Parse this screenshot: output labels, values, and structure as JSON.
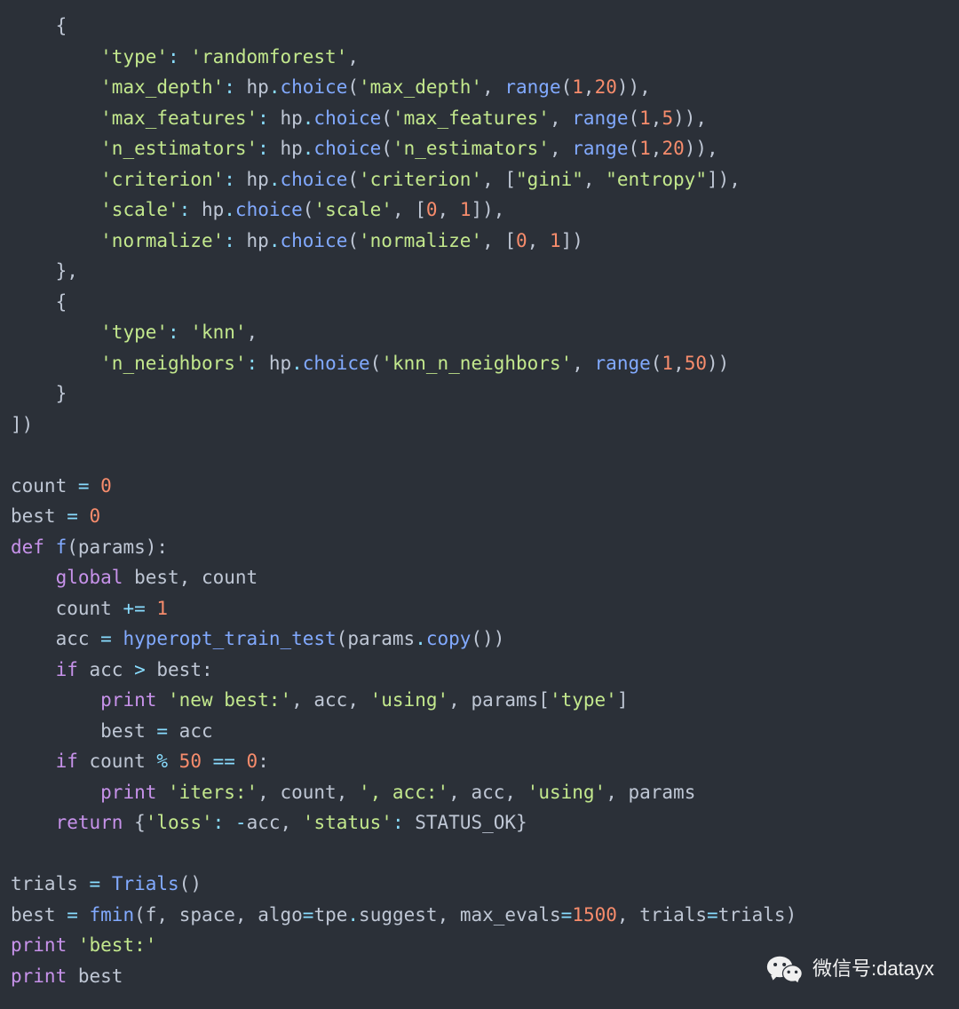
{
  "code": {
    "lines": [
      {
        "indent": 4,
        "tokens": [
          {
            "t": "pn",
            "v": "{"
          }
        ]
      },
      {
        "indent": 8,
        "tokens": [
          {
            "t": "str",
            "v": "'type'"
          },
          {
            "t": "op",
            "v": ": "
          },
          {
            "t": "str",
            "v": "'randomforest'"
          },
          {
            "t": "pn",
            "v": ","
          }
        ]
      },
      {
        "indent": 8,
        "tokens": [
          {
            "t": "str",
            "v": "'max_depth'"
          },
          {
            "t": "op",
            "v": ": "
          },
          {
            "t": "id",
            "v": "hp"
          },
          {
            "t": "op",
            "v": "."
          },
          {
            "t": "fn",
            "v": "choice"
          },
          {
            "t": "pn",
            "v": "("
          },
          {
            "t": "str",
            "v": "'max_depth'"
          },
          {
            "t": "pn",
            "v": ", "
          },
          {
            "t": "fn",
            "v": "range"
          },
          {
            "t": "pn",
            "v": "("
          },
          {
            "t": "num",
            "v": "1"
          },
          {
            "t": "pn",
            "v": ","
          },
          {
            "t": "num",
            "v": "20"
          },
          {
            "t": "pn",
            "v": ")),"
          }
        ]
      },
      {
        "indent": 8,
        "tokens": [
          {
            "t": "str",
            "v": "'max_features'"
          },
          {
            "t": "op",
            "v": ": "
          },
          {
            "t": "id",
            "v": "hp"
          },
          {
            "t": "op",
            "v": "."
          },
          {
            "t": "fn",
            "v": "choice"
          },
          {
            "t": "pn",
            "v": "("
          },
          {
            "t": "str",
            "v": "'max_features'"
          },
          {
            "t": "pn",
            "v": ", "
          },
          {
            "t": "fn",
            "v": "range"
          },
          {
            "t": "pn",
            "v": "("
          },
          {
            "t": "num",
            "v": "1"
          },
          {
            "t": "pn",
            "v": ","
          },
          {
            "t": "num",
            "v": "5"
          },
          {
            "t": "pn",
            "v": ")),"
          }
        ]
      },
      {
        "indent": 8,
        "tokens": [
          {
            "t": "str",
            "v": "'n_estimators'"
          },
          {
            "t": "op",
            "v": ": "
          },
          {
            "t": "id",
            "v": "hp"
          },
          {
            "t": "op",
            "v": "."
          },
          {
            "t": "fn",
            "v": "choice"
          },
          {
            "t": "pn",
            "v": "("
          },
          {
            "t": "str",
            "v": "'n_estimators'"
          },
          {
            "t": "pn",
            "v": ", "
          },
          {
            "t": "fn",
            "v": "range"
          },
          {
            "t": "pn",
            "v": "("
          },
          {
            "t": "num",
            "v": "1"
          },
          {
            "t": "pn",
            "v": ","
          },
          {
            "t": "num",
            "v": "20"
          },
          {
            "t": "pn",
            "v": ")),"
          }
        ]
      },
      {
        "indent": 8,
        "tokens": [
          {
            "t": "str",
            "v": "'criterion'"
          },
          {
            "t": "op",
            "v": ": "
          },
          {
            "t": "id",
            "v": "hp"
          },
          {
            "t": "op",
            "v": "."
          },
          {
            "t": "fn",
            "v": "choice"
          },
          {
            "t": "pn",
            "v": "("
          },
          {
            "t": "str",
            "v": "'criterion'"
          },
          {
            "t": "pn",
            "v": ", ["
          },
          {
            "t": "str",
            "v": "\"gini\""
          },
          {
            "t": "pn",
            "v": ", "
          },
          {
            "t": "str",
            "v": "\"entropy\""
          },
          {
            "t": "pn",
            "v": "]),"
          }
        ]
      },
      {
        "indent": 8,
        "tokens": [
          {
            "t": "str",
            "v": "'scale'"
          },
          {
            "t": "op",
            "v": ": "
          },
          {
            "t": "id",
            "v": "hp"
          },
          {
            "t": "op",
            "v": "."
          },
          {
            "t": "fn",
            "v": "choice"
          },
          {
            "t": "pn",
            "v": "("
          },
          {
            "t": "str",
            "v": "'scale'"
          },
          {
            "t": "pn",
            "v": ", ["
          },
          {
            "t": "num",
            "v": "0"
          },
          {
            "t": "pn",
            "v": ", "
          },
          {
            "t": "num",
            "v": "1"
          },
          {
            "t": "pn",
            "v": "]),"
          }
        ]
      },
      {
        "indent": 8,
        "tokens": [
          {
            "t": "str",
            "v": "'normalize'"
          },
          {
            "t": "op",
            "v": ": "
          },
          {
            "t": "id",
            "v": "hp"
          },
          {
            "t": "op",
            "v": "."
          },
          {
            "t": "fn",
            "v": "choice"
          },
          {
            "t": "pn",
            "v": "("
          },
          {
            "t": "str",
            "v": "'normalize'"
          },
          {
            "t": "pn",
            "v": ", ["
          },
          {
            "t": "num",
            "v": "0"
          },
          {
            "t": "pn",
            "v": ", "
          },
          {
            "t": "num",
            "v": "1"
          },
          {
            "t": "pn",
            "v": "])"
          }
        ]
      },
      {
        "indent": 4,
        "tokens": [
          {
            "t": "pn",
            "v": "},"
          }
        ]
      },
      {
        "indent": 4,
        "tokens": [
          {
            "t": "pn",
            "v": "{"
          }
        ]
      },
      {
        "indent": 8,
        "tokens": [
          {
            "t": "str",
            "v": "'type'"
          },
          {
            "t": "op",
            "v": ": "
          },
          {
            "t": "str",
            "v": "'knn'"
          },
          {
            "t": "pn",
            "v": ","
          }
        ]
      },
      {
        "indent": 8,
        "tokens": [
          {
            "t": "str",
            "v": "'n_neighbors'"
          },
          {
            "t": "op",
            "v": ": "
          },
          {
            "t": "id",
            "v": "hp"
          },
          {
            "t": "op",
            "v": "."
          },
          {
            "t": "fn",
            "v": "choice"
          },
          {
            "t": "pn",
            "v": "("
          },
          {
            "t": "str",
            "v": "'knn_n_neighbors'"
          },
          {
            "t": "pn",
            "v": ", "
          },
          {
            "t": "fn",
            "v": "range"
          },
          {
            "t": "pn",
            "v": "("
          },
          {
            "t": "num",
            "v": "1"
          },
          {
            "t": "pn",
            "v": ","
          },
          {
            "t": "num",
            "v": "50"
          },
          {
            "t": "pn",
            "v": "))"
          }
        ]
      },
      {
        "indent": 4,
        "tokens": [
          {
            "t": "pn",
            "v": "}"
          }
        ]
      },
      {
        "indent": 0,
        "tokens": [
          {
            "t": "pn",
            "v": "])"
          }
        ]
      },
      {
        "indent": 0,
        "tokens": []
      },
      {
        "indent": 0,
        "tokens": [
          {
            "t": "id",
            "v": "count "
          },
          {
            "t": "op",
            "v": "= "
          },
          {
            "t": "num",
            "v": "0"
          }
        ]
      },
      {
        "indent": 0,
        "tokens": [
          {
            "t": "id",
            "v": "best "
          },
          {
            "t": "op",
            "v": "= "
          },
          {
            "t": "num",
            "v": "0"
          }
        ]
      },
      {
        "indent": 0,
        "tokens": [
          {
            "t": "kw",
            "v": "def "
          },
          {
            "t": "fn",
            "v": "f"
          },
          {
            "t": "pn",
            "v": "("
          },
          {
            "t": "id",
            "v": "params"
          },
          {
            "t": "pn",
            "v": "):"
          }
        ]
      },
      {
        "indent": 4,
        "tokens": [
          {
            "t": "kw",
            "v": "global "
          },
          {
            "t": "id",
            "v": "best, count"
          }
        ]
      },
      {
        "indent": 4,
        "tokens": [
          {
            "t": "id",
            "v": "count "
          },
          {
            "t": "op",
            "v": "+= "
          },
          {
            "t": "num",
            "v": "1"
          }
        ]
      },
      {
        "indent": 4,
        "tokens": [
          {
            "t": "id",
            "v": "acc "
          },
          {
            "t": "op",
            "v": "= "
          },
          {
            "t": "fn",
            "v": "hyperopt_train_test"
          },
          {
            "t": "pn",
            "v": "("
          },
          {
            "t": "id",
            "v": "params"
          },
          {
            "t": "op",
            "v": "."
          },
          {
            "t": "fn",
            "v": "copy"
          },
          {
            "t": "pn",
            "v": "())"
          }
        ]
      },
      {
        "indent": 4,
        "tokens": [
          {
            "t": "kw",
            "v": "if "
          },
          {
            "t": "id",
            "v": "acc "
          },
          {
            "t": "op",
            "v": "> "
          },
          {
            "t": "id",
            "v": "best:"
          }
        ]
      },
      {
        "indent": 8,
        "tokens": [
          {
            "t": "kw",
            "v": "print "
          },
          {
            "t": "str",
            "v": "'new best:'"
          },
          {
            "t": "pn",
            "v": ", "
          },
          {
            "t": "id",
            "v": "acc"
          },
          {
            "t": "pn",
            "v": ", "
          },
          {
            "t": "str",
            "v": "'using'"
          },
          {
            "t": "pn",
            "v": ", "
          },
          {
            "t": "id",
            "v": "params["
          },
          {
            "t": "str",
            "v": "'type'"
          },
          {
            "t": "id",
            "v": "]"
          }
        ]
      },
      {
        "indent": 8,
        "tokens": [
          {
            "t": "id",
            "v": "best "
          },
          {
            "t": "op",
            "v": "= "
          },
          {
            "t": "id",
            "v": "acc"
          }
        ]
      },
      {
        "indent": 4,
        "tokens": [
          {
            "t": "kw",
            "v": "if "
          },
          {
            "t": "id",
            "v": "count "
          },
          {
            "t": "op",
            "v": "% "
          },
          {
            "t": "num",
            "v": "50"
          },
          {
            "t": "op",
            "v": " == "
          },
          {
            "t": "num",
            "v": "0"
          },
          {
            "t": "pn",
            "v": ":"
          }
        ]
      },
      {
        "indent": 8,
        "tokens": [
          {
            "t": "kw",
            "v": "print "
          },
          {
            "t": "str",
            "v": "'iters:'"
          },
          {
            "t": "pn",
            "v": ", "
          },
          {
            "t": "id",
            "v": "count"
          },
          {
            "t": "pn",
            "v": ", "
          },
          {
            "t": "str",
            "v": "', acc:'"
          },
          {
            "t": "pn",
            "v": ", "
          },
          {
            "t": "id",
            "v": "acc"
          },
          {
            "t": "pn",
            "v": ", "
          },
          {
            "t": "str",
            "v": "'using'"
          },
          {
            "t": "pn",
            "v": ", "
          },
          {
            "t": "id",
            "v": "params"
          }
        ]
      },
      {
        "indent": 4,
        "tokens": [
          {
            "t": "kw",
            "v": "return "
          },
          {
            "t": "pn",
            "v": "{"
          },
          {
            "t": "str",
            "v": "'loss'"
          },
          {
            "t": "op",
            "v": ": "
          },
          {
            "t": "op",
            "v": "-"
          },
          {
            "t": "id",
            "v": "acc"
          },
          {
            "t": "pn",
            "v": ", "
          },
          {
            "t": "str",
            "v": "'status'"
          },
          {
            "t": "op",
            "v": ": "
          },
          {
            "t": "id",
            "v": "STATUS_OK"
          },
          {
            "t": "pn",
            "v": "}"
          }
        ]
      },
      {
        "indent": 0,
        "tokens": []
      },
      {
        "indent": 0,
        "tokens": [
          {
            "t": "id",
            "v": "trials "
          },
          {
            "t": "op",
            "v": "= "
          },
          {
            "t": "fn",
            "v": "Trials"
          },
          {
            "t": "pn",
            "v": "()"
          }
        ]
      },
      {
        "indent": 0,
        "tokens": [
          {
            "t": "id",
            "v": "best "
          },
          {
            "t": "op",
            "v": "= "
          },
          {
            "t": "fn",
            "v": "fmin"
          },
          {
            "t": "pn",
            "v": "("
          },
          {
            "t": "id",
            "v": "f"
          },
          {
            "t": "pn",
            "v": ", "
          },
          {
            "t": "id",
            "v": "space"
          },
          {
            "t": "pn",
            "v": ", "
          },
          {
            "t": "id",
            "v": "algo"
          },
          {
            "t": "op",
            "v": "="
          },
          {
            "t": "id",
            "v": "tpe"
          },
          {
            "t": "op",
            "v": "."
          },
          {
            "t": "id",
            "v": "suggest"
          },
          {
            "t": "pn",
            "v": ", "
          },
          {
            "t": "id",
            "v": "max_evals"
          },
          {
            "t": "op",
            "v": "="
          },
          {
            "t": "num",
            "v": "1500"
          },
          {
            "t": "pn",
            "v": ", "
          },
          {
            "t": "id",
            "v": "trials"
          },
          {
            "t": "op",
            "v": "="
          },
          {
            "t": "id",
            "v": "trials"
          },
          {
            "t": "pn",
            "v": ")"
          }
        ]
      },
      {
        "indent": 0,
        "tokens": [
          {
            "t": "kw",
            "v": "print "
          },
          {
            "t": "str",
            "v": "'best:'"
          }
        ]
      },
      {
        "indent": 0,
        "tokens": [
          {
            "t": "kw",
            "v": "print "
          },
          {
            "t": "id",
            "v": "best"
          }
        ]
      }
    ]
  },
  "watermark": {
    "label": "微信号",
    "sep": ": ",
    "value": "datayx"
  }
}
